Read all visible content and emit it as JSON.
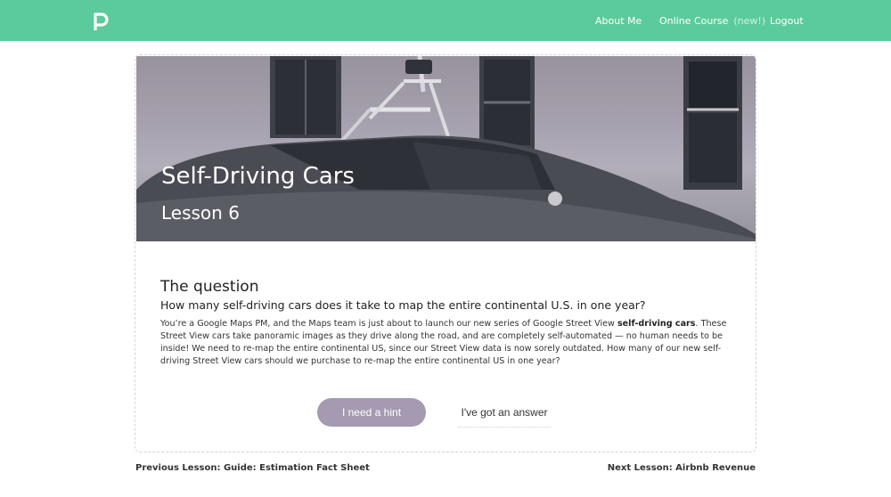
{
  "nav": {
    "logo_icon": "p-logo-icon",
    "about": "About Me",
    "course": "Online Course",
    "course_tag": "(new!)",
    "logout": "Logout",
    "bar_color": "#5ccb9b"
  },
  "hero": {
    "title": "Self-Driving Cars",
    "subtitle": "Lesson 6"
  },
  "question": {
    "heading": "The question",
    "prompt": "How many self-driving cars does it take to map the entire continental U.S. in one year?",
    "body_before": "You’re a Google Maps PM, and the Maps team is just about to launch our new series of Google Street View ",
    "body_bold": "self-driving cars",
    "body_after": ". These Street View cars take panoramic images as they drive along the road, and are completely self-automated — no human needs to be inside! We need to re-map the entire continental US, since our Street View data is now sorely outdated. How many of our new self-driving Street View cars should we purchase to re-map the entire continental US in one year?"
  },
  "buttons": {
    "hint": "I need a hint",
    "answer": "I've got an answer",
    "hint_color": "#a59ab1"
  },
  "footer": {
    "prev": "Previous Lesson: Guide: Estimation Fact Sheet",
    "next": "Next Lesson: Airbnb Revenue"
  }
}
